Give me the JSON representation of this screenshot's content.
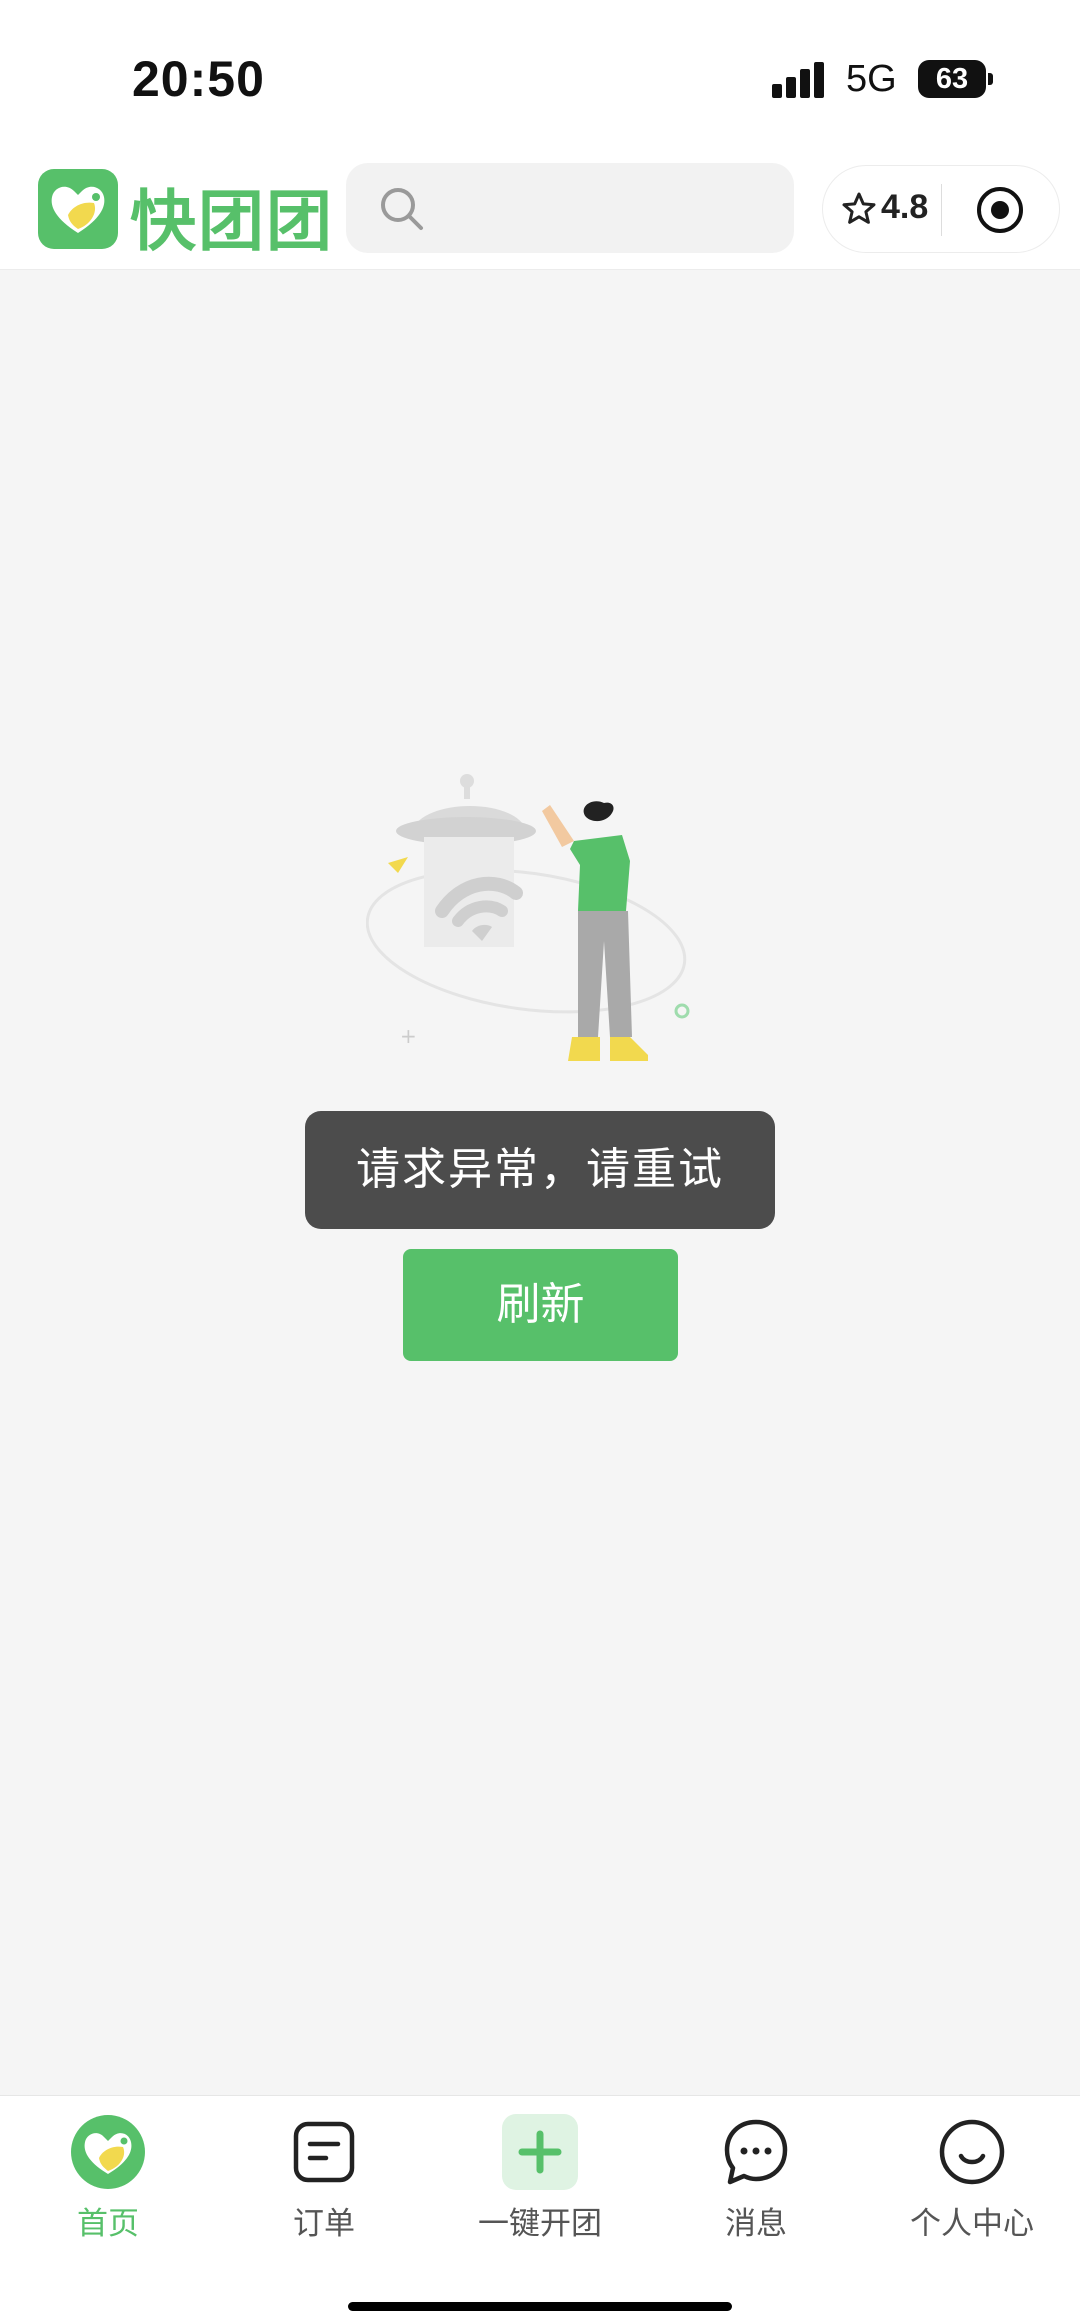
{
  "status_bar": {
    "time": "20:50",
    "network": "5G",
    "battery": "63"
  },
  "header": {
    "app_name": "快团团",
    "search_placeholder": "",
    "rating": "4.8"
  },
  "main": {
    "toast_message": "请求异常，请重试",
    "refresh_label": "刷新"
  },
  "tabbar": {
    "items": [
      {
        "label": "首页",
        "icon": "home-logo-icon",
        "active": true
      },
      {
        "label": "订单",
        "icon": "order-icon",
        "active": false
      },
      {
        "label": "一键开团",
        "icon": "plus-icon",
        "active": false
      },
      {
        "label": "消息",
        "icon": "message-icon",
        "active": false
      },
      {
        "label": "个人中心",
        "icon": "profile-icon",
        "active": false
      }
    ]
  },
  "colors": {
    "brand_green": "#57c06a",
    "toast_bg": "#4c4c4c",
    "page_bg": "#f5f5f5"
  }
}
